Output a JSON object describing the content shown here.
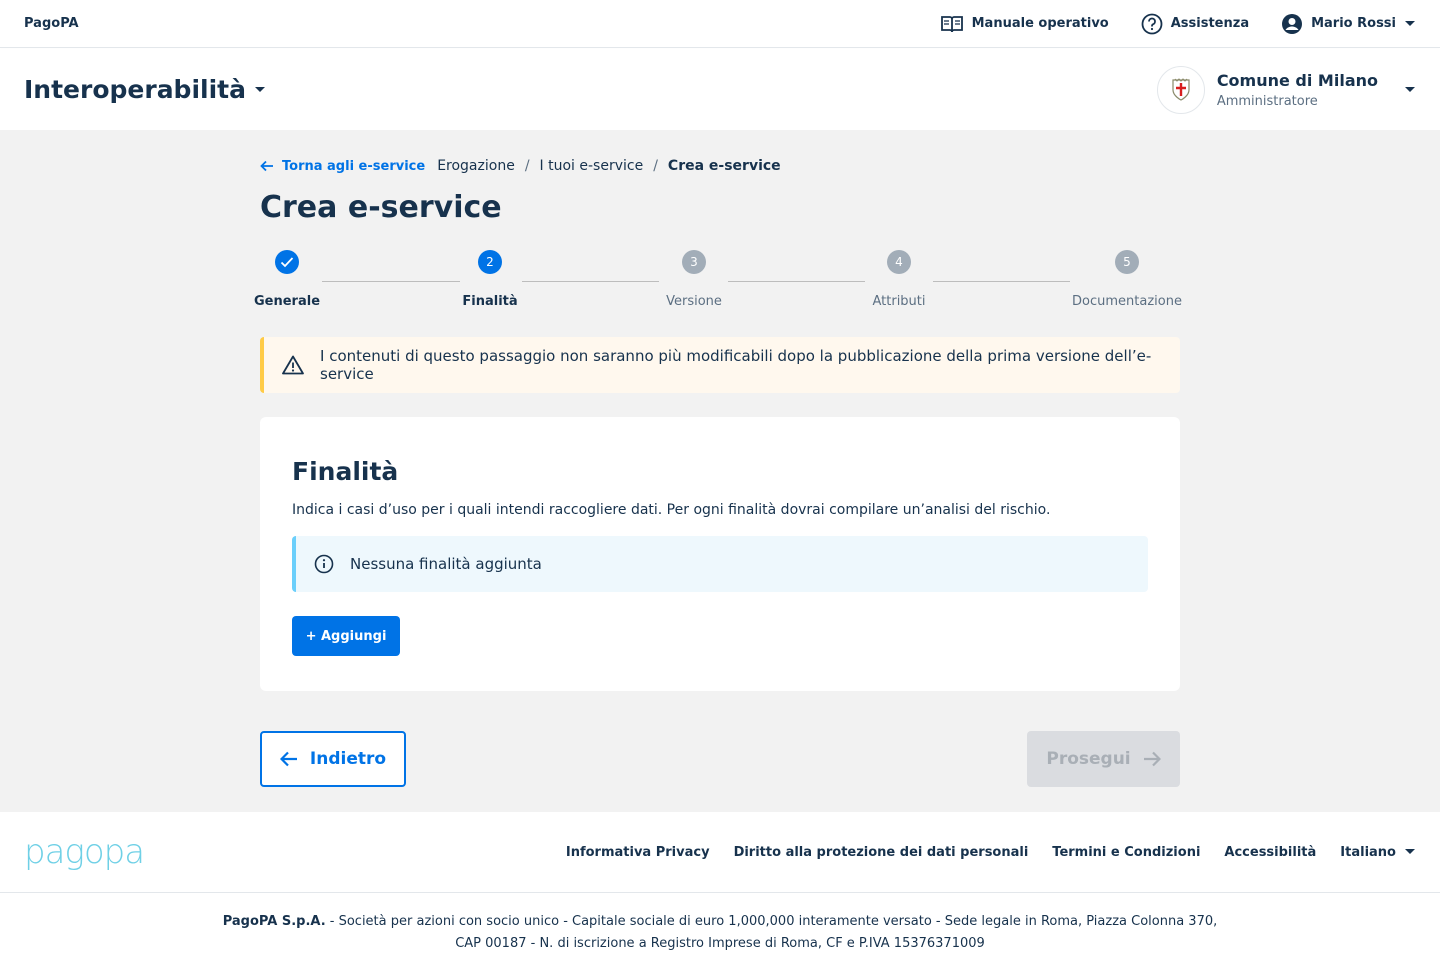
{
  "topbar": {
    "brand": "PagoPA",
    "manual": "Manuale operativo",
    "help": "Assistenza",
    "user": "Mario Rossi"
  },
  "product": {
    "title": "Interoperabilità",
    "party_name": "Comune di Milano",
    "party_role": "Amministratore"
  },
  "breadcrumb": {
    "back": "Torna agli e-service",
    "items": [
      "Erogazione",
      "I tuoi e-service",
      "Crea e-service"
    ]
  },
  "page": {
    "title": "Crea e-service"
  },
  "stepper": {
    "steps": [
      {
        "number": "1",
        "label": "Generale",
        "state": "completed"
      },
      {
        "number": "2",
        "label": "Finalità",
        "state": "active"
      },
      {
        "number": "3",
        "label": "Versione",
        "state": "pending"
      },
      {
        "number": "4",
        "label": "Attributi",
        "state": "pending"
      },
      {
        "number": "5",
        "label": "Documentazione",
        "state": "pending"
      }
    ]
  },
  "warning": {
    "text": "I contenuti di questo passaggio non saranno più modificabili dopo la pubblicazione della prima versione dell’e-service"
  },
  "card": {
    "title": "Finalità",
    "description": "Indica i casi d’uso per i quali intendi raccogliere dati. Per ogni finalità dovrai compilare un’analisi del rischio.",
    "info": "Nessuna finalità aggiunta",
    "add_button": "+ Aggiungi"
  },
  "actions": {
    "back": "Indietro",
    "next": "Prosegui"
  },
  "footer": {
    "logo": "pagopa",
    "links": [
      "Informativa Privacy",
      "Diritto alla protezione dei dati personali",
      "Termini e Condizioni",
      "Accessibilità"
    ],
    "language": "Italiano",
    "legal_company": "PagoPA S.p.A.",
    "legal_line1": " - Società per azioni con socio unico - Capitale sociale di euro 1,000,000 interamente versato - Sede legale in Roma, Piazza Colonna 370,",
    "legal_line2": "CAP 00187 - N. di iscrizione a Registro Imprese di Roma, CF e P.IVA 15376371009"
  },
  "colors": {
    "primary": "#0073E6",
    "text": "#17324D",
    "warning_border": "#FFCB46",
    "info_border": "#6BCFFB",
    "pending_step": "#A2ADB8"
  }
}
